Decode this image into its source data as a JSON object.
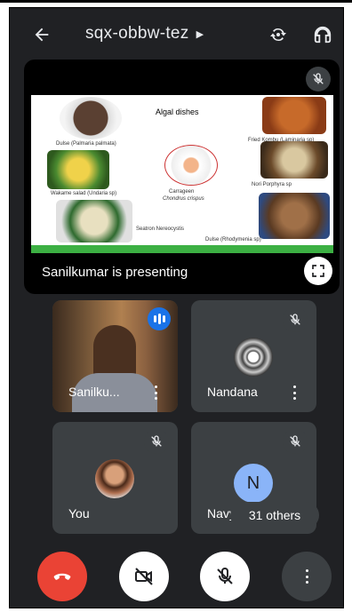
{
  "header": {
    "meeting_code": "sqx-obbw-tez",
    "back_icon": "arrow-left-icon",
    "caret_icon": "caret-right-icon",
    "switch_camera_icon": "switch-camera-icon",
    "audio_icon": "headphones-icon"
  },
  "presentation": {
    "presenter_label": "Sanilkumar is presenting",
    "slide": {
      "heading": "Algal dishes",
      "captions": [
        "Dulse (Palmaria palmata)",
        "Fried Kombu (Laminaria sp)",
        "Wakame salad (Undaria sp)",
        "Carrageen",
        "Chondrus crispus",
        "Nori Porphyra sp",
        "Seatron Nereocystis",
        "Dulse (Rhodymenia sp)"
      ]
    },
    "fullscreen_icon": "fullscreen-icon",
    "mic_status_icon": "mic-off-icon"
  },
  "participants": [
    {
      "name": "Sanilku...",
      "status_icon": "speaking-indicator-icon",
      "has_video": true
    },
    {
      "name": "Nandana",
      "status_icon": "mic-off-icon",
      "avatar": "emblem-avatar"
    },
    {
      "name": "You",
      "status_icon": "mic-off-icon",
      "avatar": "photo-avatar"
    },
    {
      "name": "Navy",
      "status_icon": "mic-off-icon",
      "avatar_letter": "N"
    }
  ],
  "others_chip": "31 others",
  "controls": {
    "end_call_icon": "phone-hangup-icon",
    "camera_icon": "camera-off-icon",
    "mic_icon": "mic-off-icon",
    "more_icon": "more-vertical-icon"
  },
  "colors": {
    "background": "#202124",
    "tile": "#3c4043",
    "end_call": "#ea4335",
    "speaking": "#1a73e8",
    "avatar_n": "#8ab4f8"
  }
}
